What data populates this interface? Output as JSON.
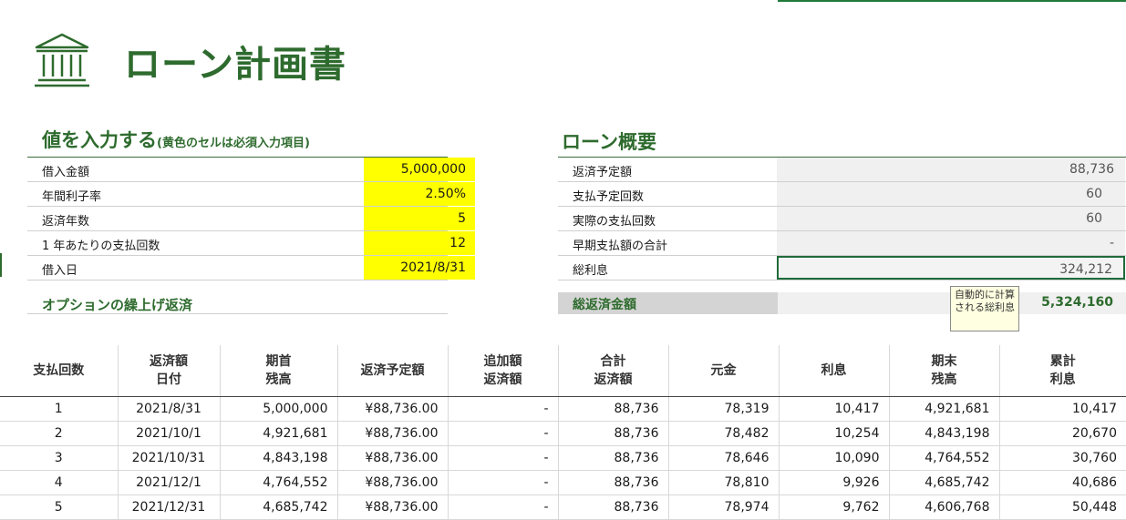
{
  "header": {
    "title": "ローン計画書",
    "icon": "bank-icon"
  },
  "input_section": {
    "title": "値を入力する",
    "note": "(黄色のセルは必須入力項目)",
    "fields": [
      {
        "label": "借入金額",
        "value": "5,000,000"
      },
      {
        "label": "年間利子率",
        "value": "2.50%"
      },
      {
        "label": "返済年数",
        "value": "5"
      },
      {
        "label": "1 年あたりの支払回数",
        "value": "12"
      },
      {
        "label": "借入日",
        "value": "2021/8/31"
      }
    ],
    "option_title": "オプションの繰上げ返済"
  },
  "summary_section": {
    "title": "ローン概要",
    "fields": [
      {
        "label": "返済予定額",
        "value": "88,736"
      },
      {
        "label": "支払予定回数",
        "value": "60"
      },
      {
        "label": "実際の支払回数",
        "value": "60"
      },
      {
        "label": "早期支払額の合計",
        "value": "-"
      },
      {
        "label": "総利息",
        "value": "324,212"
      }
    ],
    "total_label": "総返済金額",
    "total_value": "5,324,160",
    "tooltip": "自動的に計算される総利息"
  },
  "colors": {
    "accent": "#2e6b2e",
    "input_fill": "#ffff00",
    "summary_fill": "#f0f0f0"
  },
  "schedule": {
    "headers": [
      "支払回数",
      "返済額\n日付",
      "期首\n残高",
      "返済予定額",
      "追加額\n返済額",
      "合計\n返済額",
      "元金",
      "利息",
      "期末\n残高",
      "累計\n利息"
    ],
    "rows": [
      [
        "1",
        "2021/8/31",
        "5,000,000",
        "¥88,736.00",
        "-",
        "88,736",
        "78,319",
        "10,417",
        "4,921,681",
        "10,417"
      ],
      [
        "2",
        "2021/10/1",
        "4,921,681",
        "¥88,736.00",
        "-",
        "88,736",
        "78,482",
        "10,254",
        "4,843,198",
        "20,670"
      ],
      [
        "3",
        "2021/10/31",
        "4,843,198",
        "¥88,736.00",
        "-",
        "88,736",
        "78,646",
        "10,090",
        "4,764,552",
        "30,760"
      ],
      [
        "4",
        "2021/12/1",
        "4,764,552",
        "¥88,736.00",
        "-",
        "88,736",
        "78,810",
        "9,926",
        "4,685,742",
        "40,686"
      ],
      [
        "5",
        "2021/12/31",
        "4,685,742",
        "¥88,736.00",
        "-",
        "88,736",
        "78,974",
        "9,762",
        "4,606,768",
        "50,448"
      ]
    ]
  }
}
